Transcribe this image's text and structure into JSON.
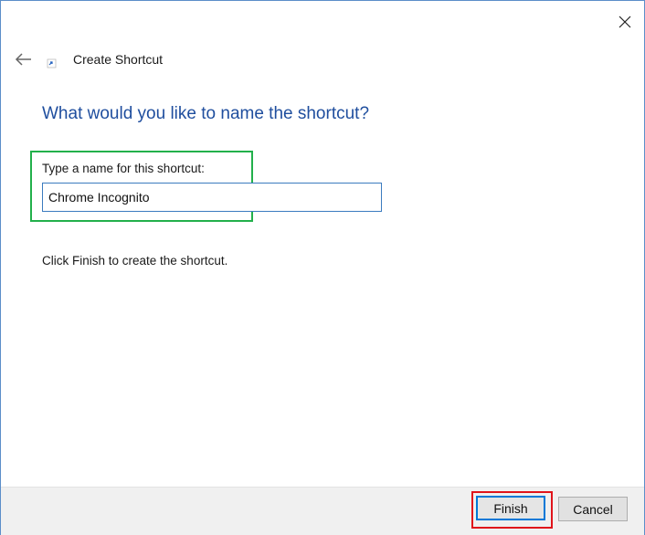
{
  "window": {
    "title": "Create Shortcut",
    "close_icon": "close-icon",
    "back_icon": "back-arrow-icon",
    "wizard_icon": "shortcut-icon"
  },
  "main": {
    "heading": "What would you like to name the shortcut?",
    "field_label": "Type a name for this shortcut:",
    "name_value": "Chrome Incognito",
    "hint": "Click Finish to create the shortcut."
  },
  "footer": {
    "finish_label": "Finish",
    "cancel_label": "Cancel"
  },
  "highlights": {
    "name_field_box_color": "#22b04b",
    "finish_button_box_color": "#e0141b"
  },
  "colors": {
    "heading": "#1f4e9e",
    "accent": "#0078d7"
  }
}
